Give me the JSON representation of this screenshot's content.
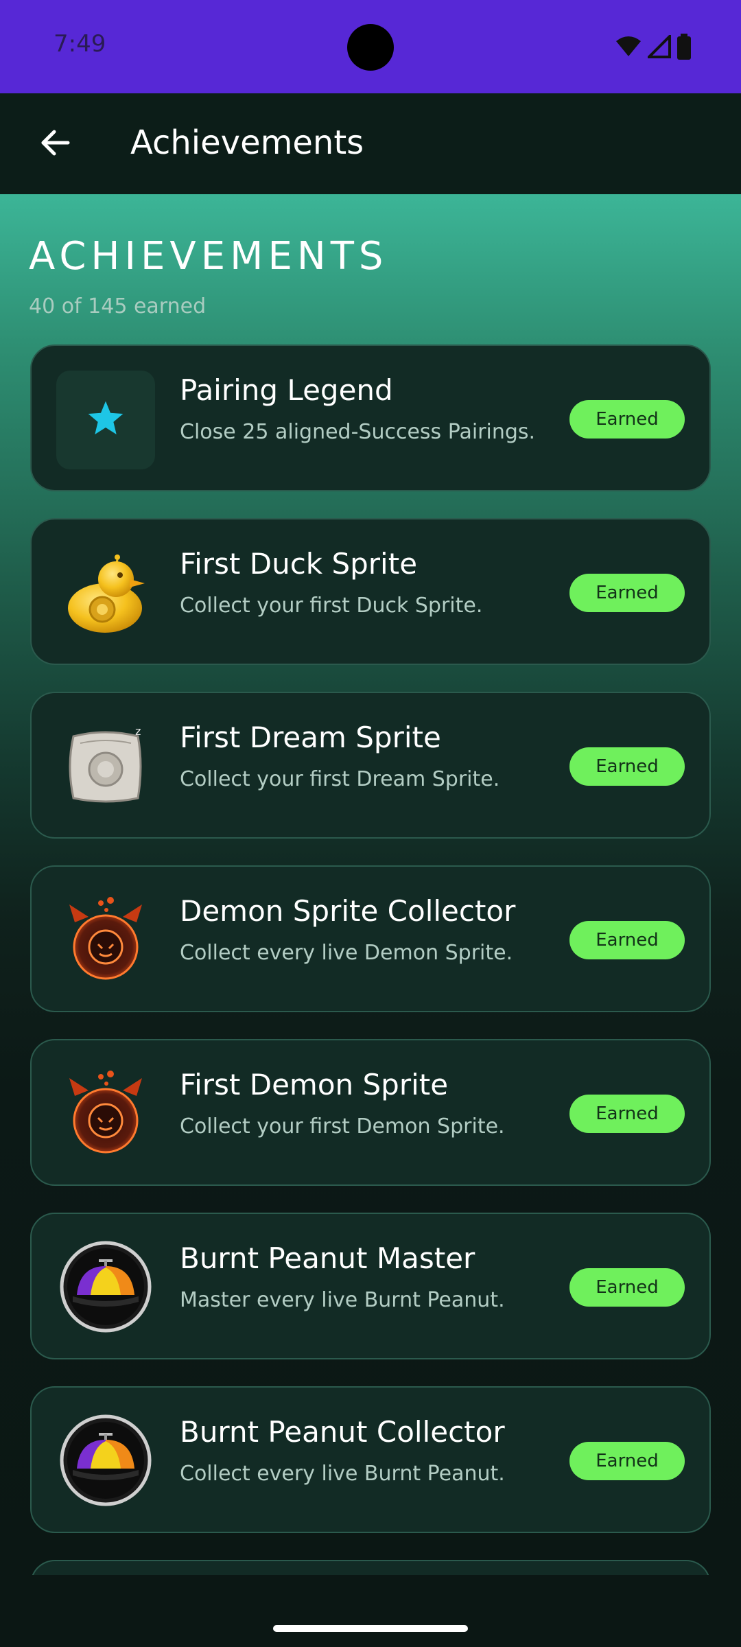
{
  "status_bar": {
    "time": "7:49",
    "background": "#5728d6",
    "icons": [
      "wifi-icon",
      "cell-signal-icon",
      "battery-icon"
    ]
  },
  "app_bar": {
    "title": "Achievements",
    "back_icon": "arrow-left-icon"
  },
  "header": {
    "title": "ACHIEVEMENTS",
    "subtitle": "40 of 145 earned"
  },
  "colors": {
    "accent_green": "#6ff05c",
    "card_background": "#122b25",
    "gradient_top": "#3cb597"
  },
  "achievements": [
    {
      "title": "Pairing Legend",
      "description": "Close 25 aligned-Success Pairings.",
      "status": "Earned",
      "icon": "star-icon"
    },
    {
      "title": "First Duck Sprite",
      "description": "Collect your first Duck Sprite.",
      "status": "Earned",
      "icon": "duck-sprite-icon"
    },
    {
      "title": "First Dream Sprite",
      "description": "Collect your first Dream Sprite.",
      "status": "Earned",
      "icon": "dream-pillow-sprite-icon"
    },
    {
      "title": "Demon Sprite Collector",
      "description": "Collect every live Demon Sprite.",
      "status": "Earned",
      "icon": "demon-sprite-icon"
    },
    {
      "title": "First Demon Sprite",
      "description": "Collect your first Demon Sprite.",
      "status": "Earned",
      "icon": "demon-sprite-icon"
    },
    {
      "title": "Burnt Peanut Master",
      "description": "Master every live Burnt Peanut.",
      "status": "Earned",
      "icon": "propeller-cap-icon"
    },
    {
      "title": "Burnt Peanut Collector",
      "description": "Collect every live Burnt Peanut.",
      "status": "Earned",
      "icon": "propeller-cap-icon"
    }
  ]
}
